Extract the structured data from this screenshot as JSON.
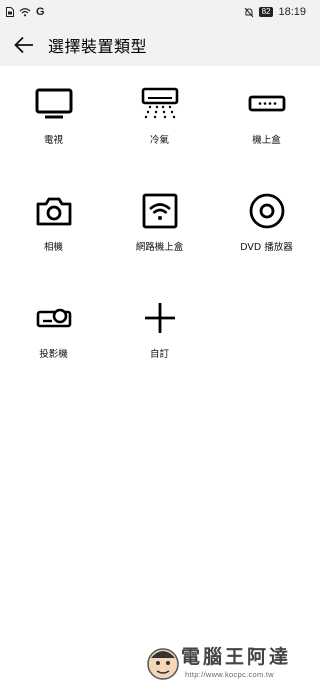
{
  "status_bar": {
    "carrier": "G",
    "battery": "82",
    "time": "18:19"
  },
  "app_bar": {
    "title": "選擇裝置類型",
    "back_icon": "arrow-left-icon"
  },
  "devices": [
    {
      "label": "電視",
      "icon": "tv-icon"
    },
    {
      "label": "冷氣",
      "icon": "air-conditioner-icon"
    },
    {
      "label": "機上盒",
      "icon": "set-top-box-icon"
    },
    {
      "label": "相機",
      "icon": "camera-icon"
    },
    {
      "label": "網路機上盒",
      "icon": "network-box-icon"
    },
    {
      "label": "DVD 播放器",
      "icon": "dvd-player-icon"
    },
    {
      "label": "投影機",
      "icon": "projector-icon"
    },
    {
      "label": "自訂",
      "icon": "plus-icon"
    }
  ],
  "watermark": {
    "text": "電腦王阿達",
    "url": "http://www.kocpc.com.tw"
  }
}
